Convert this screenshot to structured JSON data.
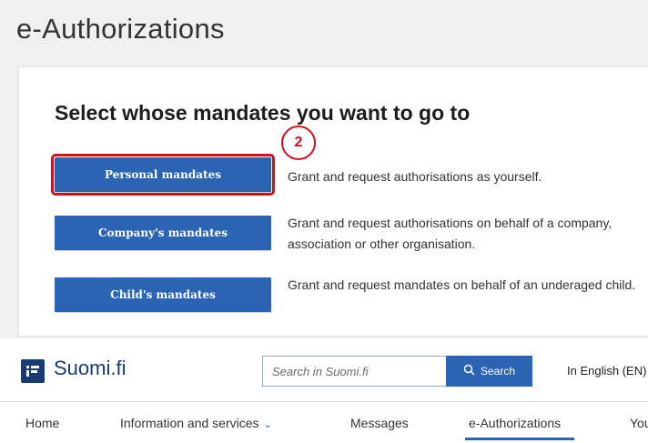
{
  "page": {
    "title": "e-Authorizations"
  },
  "card": {
    "title": "Select whose mandates you want to go to",
    "annotation": "2",
    "options": [
      {
        "button": "Personal mandates",
        "description": "Grant and request authorisations as yourself."
      },
      {
        "button": "Company's mandates",
        "description": "Grant and request authorisations on behalf of a company, association or other organisation."
      },
      {
        "button": "Child's mandates",
        "description": "Grant and request mandates on behalf of an underaged child."
      }
    ]
  },
  "header": {
    "logo_text": "Suomi.fi",
    "search_placeholder": "Search in Suomi.fi",
    "search_button": "Search",
    "language": "In English (EN)"
  },
  "nav": {
    "items": [
      "Home",
      "Information and services",
      "Messages",
      "e-Authorizations",
      "You"
    ],
    "active": "e-Authorizations"
  },
  "colors": {
    "primary": "#2a64b3",
    "highlight": "#d0101b",
    "logo": "#1a3b75"
  }
}
